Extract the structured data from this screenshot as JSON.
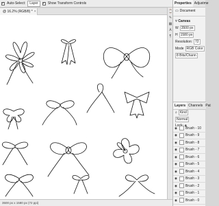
{
  "options_bar": {
    "auto_select_label": "Auto-Select:",
    "auto_select_target": "Layer",
    "show_transform_label": "Show Transform Controls"
  },
  "document_tab": {
    "title": "@ 16.2% (RGB/8) *",
    "close": "×"
  },
  "status_bar": {
    "text": "3500 px x 1580 px (72 ppi)"
  },
  "properties": {
    "tabs": [
      "Properties",
      "Adjustme"
    ],
    "doc_label": "Document",
    "canvas_section": "Canvas",
    "width_label": "W",
    "width_value": "3500 px",
    "height_label": "H",
    "height_value": "1580 px",
    "resolution_label": "Resolution:",
    "resolution_value": "72",
    "mode_label": "Mode",
    "mode_value": "RGB Color",
    "depth_value": "8 Bits/Chann"
  },
  "layers": {
    "tabs": [
      "Layers",
      "Channels",
      "Pat"
    ],
    "kind_label": "Kind",
    "blend_mode": "Normal",
    "lock_label": "Lock:",
    "items": [
      {
        "name": "Brush - 10"
      },
      {
        "name": "Brush - 9"
      },
      {
        "name": "Brush - 8"
      },
      {
        "name": "Brush - 7"
      },
      {
        "name": "Brush - 6"
      },
      {
        "name": "Brush - 5"
      },
      {
        "name": "Brush - 4"
      },
      {
        "name": "Brush - 3"
      },
      {
        "name": "Brush - 2"
      },
      {
        "name": "Brush - 1"
      },
      {
        "name": "Brush - 0"
      }
    ]
  },
  "icons": {
    "checkbox": "checkbox-icon",
    "eye": "eye-icon",
    "document": "document-icon"
  }
}
